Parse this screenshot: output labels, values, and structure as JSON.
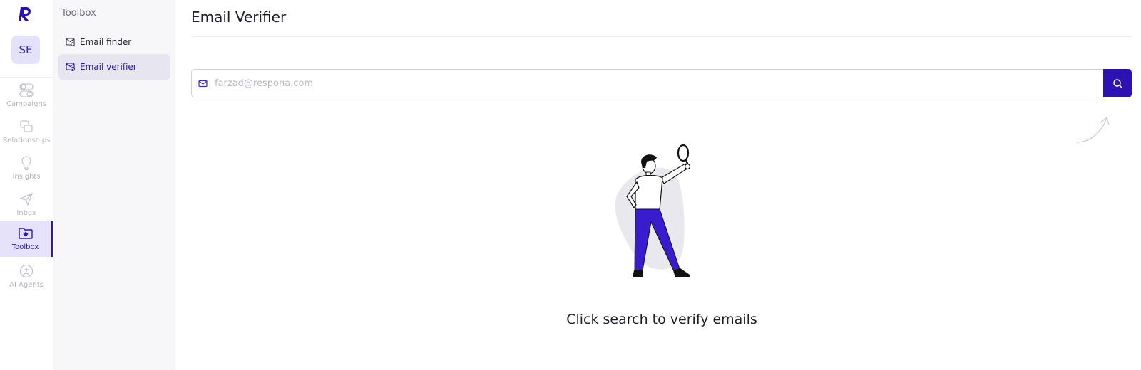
{
  "rail": {
    "avatar_initials": "SE",
    "items": [
      {
        "label": "Campaigns",
        "icon": "campaigns-icon"
      },
      {
        "label": "Relationships",
        "icon": "relationships-icon"
      },
      {
        "label": "Insights",
        "icon": "lightbulb-icon"
      },
      {
        "label": "Inbox",
        "icon": "paper-plane-icon"
      },
      {
        "label": "Toolbox",
        "icon": "folder-gear-icon",
        "active": true
      },
      {
        "label": "AI Agents",
        "icon": "ai-agent-icon"
      }
    ]
  },
  "subnav": {
    "title": "Toolbox",
    "items": [
      {
        "label": "Email finder",
        "icon": "email-finder-icon"
      },
      {
        "label": "Email verifier",
        "icon": "email-verifier-icon",
        "active": true
      }
    ]
  },
  "main": {
    "title": "Email Verifier",
    "search": {
      "placeholder": "farzad@respona.com",
      "value": ""
    },
    "empty_state": "Click search to verify emails"
  },
  "colors": {
    "accent": "#2d12b3",
    "active_bg": "#e6e2fb",
    "sidebar_bg": "#f7f7fa",
    "pants": "#3a1ccf"
  }
}
